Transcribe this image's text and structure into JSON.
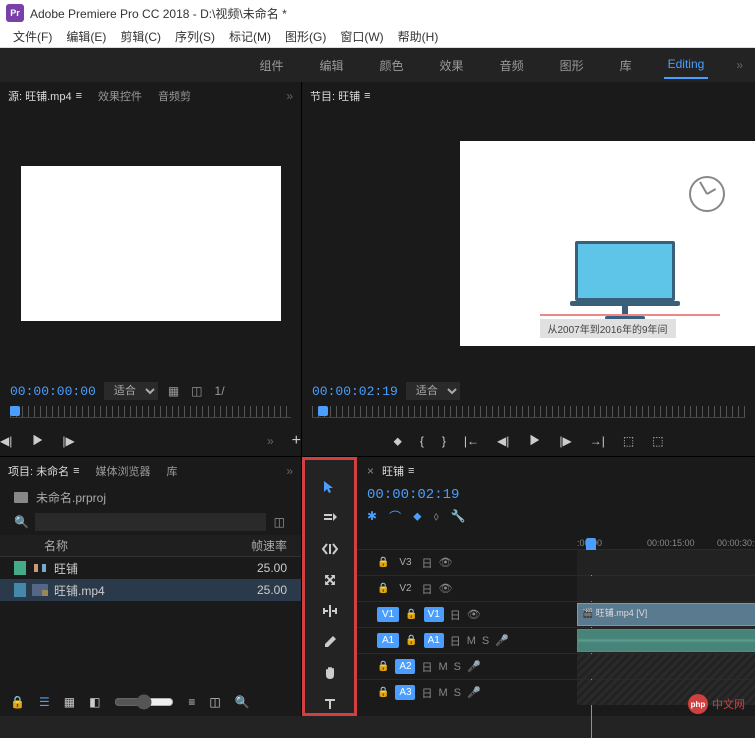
{
  "titlebar": {
    "app_icon_text": "Pr",
    "title": "Adobe Premiere Pro CC 2018 - D:\\视频\\未命名 *"
  },
  "menubar": {
    "items": [
      "文件(F)",
      "编辑(E)",
      "剪辑(C)",
      "序列(S)",
      "标记(M)",
      "图形(G)",
      "窗口(W)",
      "帮助(H)"
    ]
  },
  "workspaces": {
    "items": [
      "组件",
      "编辑",
      "颜色",
      "效果",
      "音频",
      "图形",
      "库",
      "Editing"
    ],
    "arrow": "»"
  },
  "source_panel": {
    "tabs": {
      "source": "源: 旺铺.mp4",
      "effect": "效果控件",
      "audio": "音频剪",
      "more": "»"
    },
    "timecode": "00:00:00:00",
    "fit": "适合",
    "page_info": "1/"
  },
  "program_panel": {
    "tab": "节目: 旺铺",
    "subtitle": "从2007年到2016年的9年间",
    "timecode": "00:00:02:19",
    "fit": "适合"
  },
  "project_panel": {
    "tabs": {
      "project": "项目: 未命名",
      "media": "媒体浏览器",
      "lib": "库",
      "more": "»"
    },
    "filename": "未命名.prproj",
    "cols": {
      "name": "名称",
      "fps": "帧速率"
    },
    "items": [
      {
        "name": "旺铺",
        "fps": "25.00",
        "type": "sequence"
      },
      {
        "name": "旺铺.mp4",
        "fps": "25.00",
        "type": "clip"
      }
    ]
  },
  "timeline": {
    "tab": "旺铺",
    "timecode": "00:00:02:19",
    "ruler": {
      "t0": ":00:00",
      "t1": "00:00:15:00",
      "t2": "00:00:30:0"
    },
    "tracks": {
      "v3": "V3",
      "v2": "V2",
      "v1": "V1",
      "a1": "A1",
      "a2": "A2",
      "a3": "A3",
      "v1_src": "V1",
      "a1_src": "A1"
    },
    "clip_name": "旺铺.mp4 [V]",
    "toggles": {
      "m": "M",
      "s": "S"
    }
  },
  "watermark": {
    "icon": "php",
    "text": "中文网"
  }
}
